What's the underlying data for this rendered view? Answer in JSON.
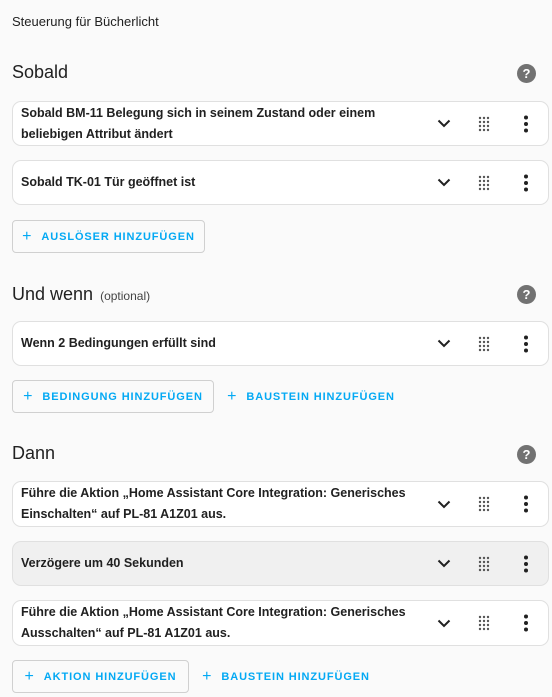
{
  "description": "Steuerung für Bücherlicht",
  "triggers": {
    "title": "Sobald",
    "items": [
      {
        "label": "Sobald BM-11 Belegung sich in seinem Zustand oder einem beliebigen Attribut ändert"
      },
      {
        "label": "Sobald TK-01 Tür geöffnet ist"
      }
    ],
    "add_button": "AUSLÖSER HINZUFÜGEN"
  },
  "conditions": {
    "title": "Und wenn",
    "optional_label": "(optional)",
    "items": [
      {
        "label": "Wenn 2 Bedingungen erfüllt sind"
      }
    ],
    "add_button": "BEDINGUNG HINZUFÜGEN",
    "add_block_button": "BAUSTEIN HINZUFÜGEN"
  },
  "actions": {
    "title": "Dann",
    "items": [
      {
        "label": "Führe die Aktion „Home Assistant Core Integration: Generisches Einschalten“ auf PL-81 A1Z01 aus."
      },
      {
        "label": "Verzögere um 40 Sekunden",
        "disabled": true
      },
      {
        "label": "Führe die Aktion „Home Assistant Core Integration: Generisches Ausschalten“ auf PL-81 A1Z01 aus."
      }
    ],
    "add_button": "AKTION HINZUFÜGEN",
    "add_block_button": "BAUSTEIN HINZUFÜGEN"
  },
  "icons": {
    "help": "help-circle-icon",
    "expand": "chevron-down-icon",
    "drag": "drag-handle-icon",
    "overflow": "dots-vertical-icon",
    "add": "plus-icon"
  },
  "help_glyph": "?",
  "add_glyph": "+",
  "colors": {
    "accent": "#03a9f4",
    "help_icon": "#727272",
    "card_border": "#e0e0e0",
    "disabled_card": "#f0f0f0"
  }
}
